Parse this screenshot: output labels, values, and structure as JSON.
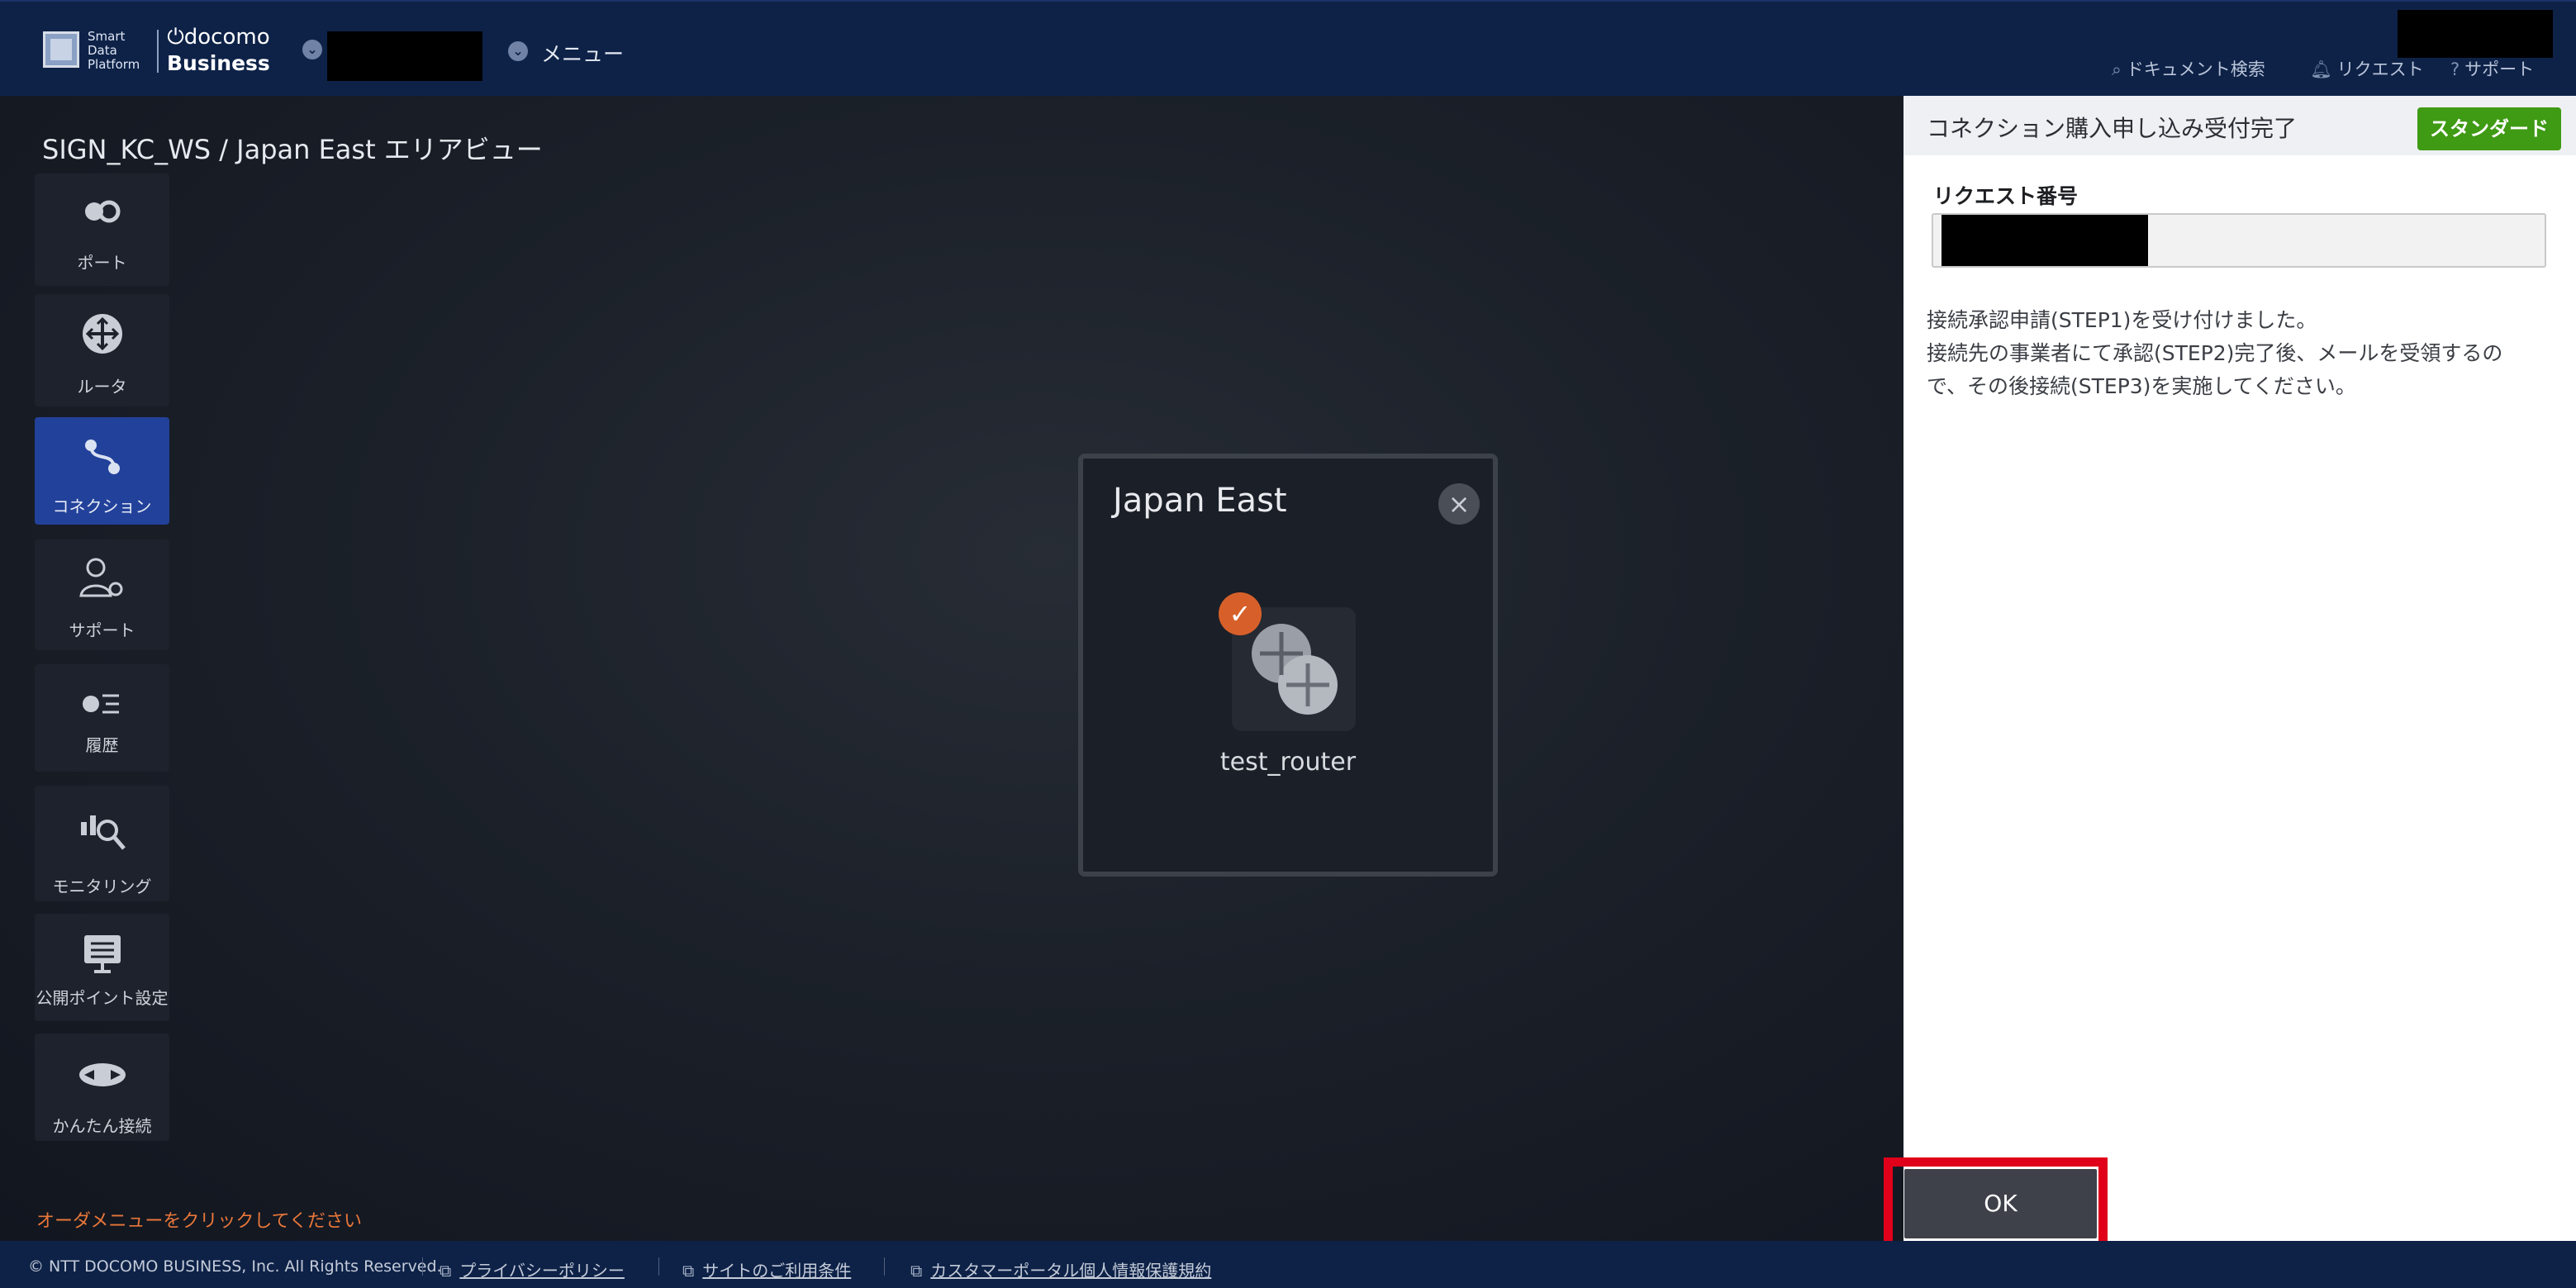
{
  "header": {
    "logo_text": [
      "Smart",
      "Data",
      "Platform"
    ],
    "brand_top": "docomo",
    "brand_bottom": "Business",
    "menu_label": "メニュー",
    "links": {
      "doc_search": "ドキュメント検索",
      "request": "リクエスト",
      "support": "サポート"
    }
  },
  "main": {
    "breadcrumb": "SIGN_KC_WS / Japan East エリアビュー",
    "sidebar": [
      {
        "label": "ポート",
        "icon": "port-icon"
      },
      {
        "label": "ルータ",
        "icon": "router-icon"
      },
      {
        "label": "コネクション",
        "icon": "connection-icon",
        "active": true
      },
      {
        "label": "サポート",
        "icon": "support-user-icon"
      },
      {
        "label": "履歴",
        "icon": "history-icon"
      },
      {
        "label": "モニタリング",
        "icon": "monitoring-icon"
      },
      {
        "label": "公開ポイント設定",
        "icon": "public-point-icon"
      },
      {
        "label": "かんたん接続",
        "icon": "easy-connect-icon"
      }
    ],
    "order_hint": "オーダメニューをクリックしてください",
    "area_card": {
      "title": "Japan East",
      "router_name": "test_router"
    }
  },
  "panel": {
    "title": "コネクション購入申し込み受付完了",
    "plan_badge": "スタンダード",
    "request_number_label": "リクエスト番号",
    "message_lines": [
      "接続承認申請(STEP1)を受け付けました。",
      "接続先の事業者にて承認(STEP2)完了後、メールを受領するの",
      "で、その後接続(STEP3)を実施してください。"
    ],
    "ok_label": "OK"
  },
  "footer": {
    "copyright": "© NTT DOCOMO BUSINESS, Inc. All Rights Reserved.",
    "links": [
      "プライバシーポリシー",
      "サイトのご利用条件",
      "カスタマーポータル個人情報保護規約"
    ]
  },
  "colors": {
    "header_bg": "#0e2248",
    "active_nav": "#22419a",
    "plan_badge": "#3f9a14",
    "check_badge": "#d7602a",
    "highlight": "#e0001a",
    "hint_text": "#e8773a"
  }
}
